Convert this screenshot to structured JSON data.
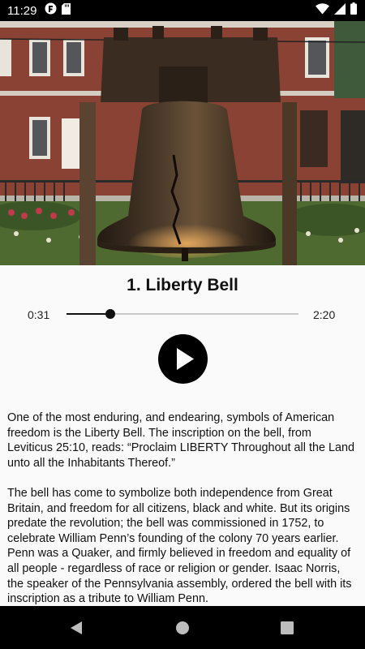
{
  "status_bar": {
    "time": "11:29",
    "left_icons": [
      "app-notification-icon",
      "sd-card-icon"
    ],
    "right_icons": [
      "wifi-icon",
      "cellular-signal-icon",
      "battery-icon"
    ]
  },
  "hero": {
    "image": "liberty-bell-photo",
    "colors": {
      "brick": "#7a3a2c",
      "bell": "#3a2e22",
      "foliage": "#4a6a2a",
      "flowers": "#b23a4a"
    }
  },
  "track": {
    "title": "1. Liberty Bell",
    "current_time": "0:31",
    "total_time": "2:20",
    "progress": 0.19
  },
  "controls": {
    "play_icon": "play-icon"
  },
  "description": {
    "paragraphs": [
      "One of the most enduring, and endearing, symbols of American freedom is the Liberty Bell. The inscription on the bell, from Leviticus 25:10, reads: “Proclaim LIBERTY Throughout all the Land unto all the Inhabitants Thereof.”",
      "The bell has come to symbolize both independence from Great Britain, and freedom for all citizens, black and white. But its origins predate the revolution; the bell was commissioned in 1752, to celebrate William Penn’s founding of the colony 70 years earlier. Penn was a Quaker, and firmly believed in freedom and equality of all people - regardless of race or religion or gender. Isaac Norris, the speaker of the Pennsylvania assembly, ordered the bell with its inscription as a tribute to William Penn."
    ]
  },
  "nav_bar": {
    "buttons": [
      "back-icon",
      "home-icon",
      "recents-icon"
    ]
  }
}
